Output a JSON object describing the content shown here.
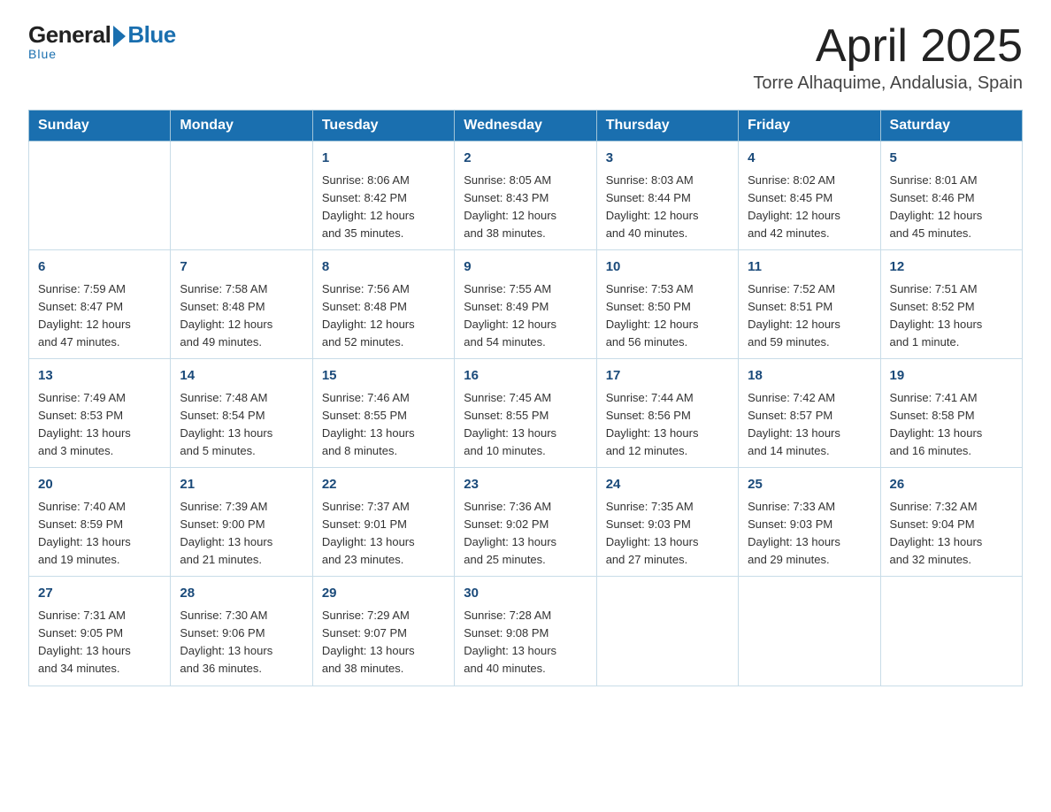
{
  "logo": {
    "general": "General",
    "blue": "Blue",
    "underline": "Blue"
  },
  "header": {
    "month_year": "April 2025",
    "location": "Torre Alhaquime, Andalusia, Spain"
  },
  "weekdays": [
    "Sunday",
    "Monday",
    "Tuesday",
    "Wednesday",
    "Thursday",
    "Friday",
    "Saturday"
  ],
  "weeks": [
    [
      {
        "day": "",
        "info": ""
      },
      {
        "day": "",
        "info": ""
      },
      {
        "day": "1",
        "info": "Sunrise: 8:06 AM\nSunset: 8:42 PM\nDaylight: 12 hours\nand 35 minutes."
      },
      {
        "day": "2",
        "info": "Sunrise: 8:05 AM\nSunset: 8:43 PM\nDaylight: 12 hours\nand 38 minutes."
      },
      {
        "day": "3",
        "info": "Sunrise: 8:03 AM\nSunset: 8:44 PM\nDaylight: 12 hours\nand 40 minutes."
      },
      {
        "day": "4",
        "info": "Sunrise: 8:02 AM\nSunset: 8:45 PM\nDaylight: 12 hours\nand 42 minutes."
      },
      {
        "day": "5",
        "info": "Sunrise: 8:01 AM\nSunset: 8:46 PM\nDaylight: 12 hours\nand 45 minutes."
      }
    ],
    [
      {
        "day": "6",
        "info": "Sunrise: 7:59 AM\nSunset: 8:47 PM\nDaylight: 12 hours\nand 47 minutes."
      },
      {
        "day": "7",
        "info": "Sunrise: 7:58 AM\nSunset: 8:48 PM\nDaylight: 12 hours\nand 49 minutes."
      },
      {
        "day": "8",
        "info": "Sunrise: 7:56 AM\nSunset: 8:48 PM\nDaylight: 12 hours\nand 52 minutes."
      },
      {
        "day": "9",
        "info": "Sunrise: 7:55 AM\nSunset: 8:49 PM\nDaylight: 12 hours\nand 54 minutes."
      },
      {
        "day": "10",
        "info": "Sunrise: 7:53 AM\nSunset: 8:50 PM\nDaylight: 12 hours\nand 56 minutes."
      },
      {
        "day": "11",
        "info": "Sunrise: 7:52 AM\nSunset: 8:51 PM\nDaylight: 12 hours\nand 59 minutes."
      },
      {
        "day": "12",
        "info": "Sunrise: 7:51 AM\nSunset: 8:52 PM\nDaylight: 13 hours\nand 1 minute."
      }
    ],
    [
      {
        "day": "13",
        "info": "Sunrise: 7:49 AM\nSunset: 8:53 PM\nDaylight: 13 hours\nand 3 minutes."
      },
      {
        "day": "14",
        "info": "Sunrise: 7:48 AM\nSunset: 8:54 PM\nDaylight: 13 hours\nand 5 minutes."
      },
      {
        "day": "15",
        "info": "Sunrise: 7:46 AM\nSunset: 8:55 PM\nDaylight: 13 hours\nand 8 minutes."
      },
      {
        "day": "16",
        "info": "Sunrise: 7:45 AM\nSunset: 8:55 PM\nDaylight: 13 hours\nand 10 minutes."
      },
      {
        "day": "17",
        "info": "Sunrise: 7:44 AM\nSunset: 8:56 PM\nDaylight: 13 hours\nand 12 minutes."
      },
      {
        "day": "18",
        "info": "Sunrise: 7:42 AM\nSunset: 8:57 PM\nDaylight: 13 hours\nand 14 minutes."
      },
      {
        "day": "19",
        "info": "Sunrise: 7:41 AM\nSunset: 8:58 PM\nDaylight: 13 hours\nand 16 minutes."
      }
    ],
    [
      {
        "day": "20",
        "info": "Sunrise: 7:40 AM\nSunset: 8:59 PM\nDaylight: 13 hours\nand 19 minutes."
      },
      {
        "day": "21",
        "info": "Sunrise: 7:39 AM\nSunset: 9:00 PM\nDaylight: 13 hours\nand 21 minutes."
      },
      {
        "day": "22",
        "info": "Sunrise: 7:37 AM\nSunset: 9:01 PM\nDaylight: 13 hours\nand 23 minutes."
      },
      {
        "day": "23",
        "info": "Sunrise: 7:36 AM\nSunset: 9:02 PM\nDaylight: 13 hours\nand 25 minutes."
      },
      {
        "day": "24",
        "info": "Sunrise: 7:35 AM\nSunset: 9:03 PM\nDaylight: 13 hours\nand 27 minutes."
      },
      {
        "day": "25",
        "info": "Sunrise: 7:33 AM\nSunset: 9:03 PM\nDaylight: 13 hours\nand 29 minutes."
      },
      {
        "day": "26",
        "info": "Sunrise: 7:32 AM\nSunset: 9:04 PM\nDaylight: 13 hours\nand 32 minutes."
      }
    ],
    [
      {
        "day": "27",
        "info": "Sunrise: 7:31 AM\nSunset: 9:05 PM\nDaylight: 13 hours\nand 34 minutes."
      },
      {
        "day": "28",
        "info": "Sunrise: 7:30 AM\nSunset: 9:06 PM\nDaylight: 13 hours\nand 36 minutes."
      },
      {
        "day": "29",
        "info": "Sunrise: 7:29 AM\nSunset: 9:07 PM\nDaylight: 13 hours\nand 38 minutes."
      },
      {
        "day": "30",
        "info": "Sunrise: 7:28 AM\nSunset: 9:08 PM\nDaylight: 13 hours\nand 40 minutes."
      },
      {
        "day": "",
        "info": ""
      },
      {
        "day": "",
        "info": ""
      },
      {
        "day": "",
        "info": ""
      }
    ]
  ]
}
